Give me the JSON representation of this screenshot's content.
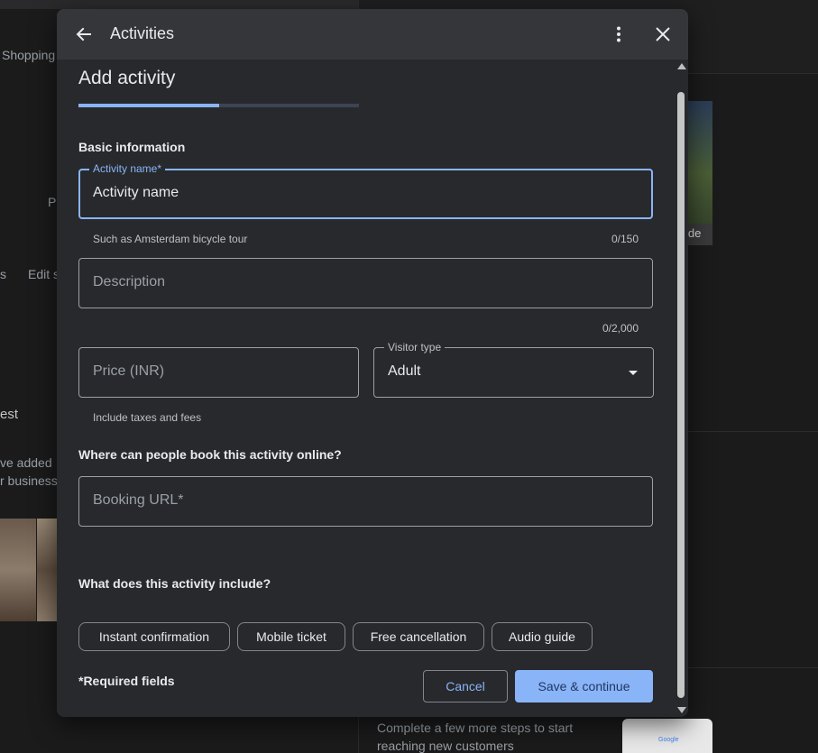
{
  "background": {
    "shopping_label": "Shopping",
    "left_fragments": [
      "P",
      "s",
      "Edit s",
      "est",
      "ve added",
      "r business"
    ],
    "right_card_label": "ide",
    "bottom_text_line1": "Complete a few more steps to start",
    "bottom_text_line2": "reaching new customers",
    "google_mini": "Google"
  },
  "dialog": {
    "title": "Activities",
    "back_icon": "arrow-back-icon",
    "more_icon": "more-vert-icon",
    "close_icon": "close-icon"
  },
  "form": {
    "heading": "Add activity",
    "progress_fraction": 0.5,
    "section_basic": "Basic information",
    "activity_name": {
      "label": "Activity name*",
      "placeholder": "Activity name",
      "hint": "Such as Amsterdam bicycle tour",
      "counter": "0/150"
    },
    "description": {
      "placeholder": "Description",
      "counter": "0/2,000"
    },
    "price": {
      "placeholder": "Price (INR)",
      "hint": "Include taxes and fees"
    },
    "visitor_type": {
      "label": "Visitor type",
      "value": "Adult"
    },
    "section_booking": "Where can people book this activity online?",
    "booking_url": {
      "placeholder": "Booking URL*"
    },
    "section_includes": "What does this activity include?",
    "chips": [
      "Instant confirmation",
      "Mobile ticket",
      "Free cancellation",
      "Audio guide"
    ],
    "required_note": "*Required fields",
    "cancel_label": "Cancel",
    "save_label": "Save & continue"
  },
  "colors": {
    "accent": "#8ab4f8",
    "dialog_bg": "#28292c",
    "header_bg": "#35363a"
  }
}
